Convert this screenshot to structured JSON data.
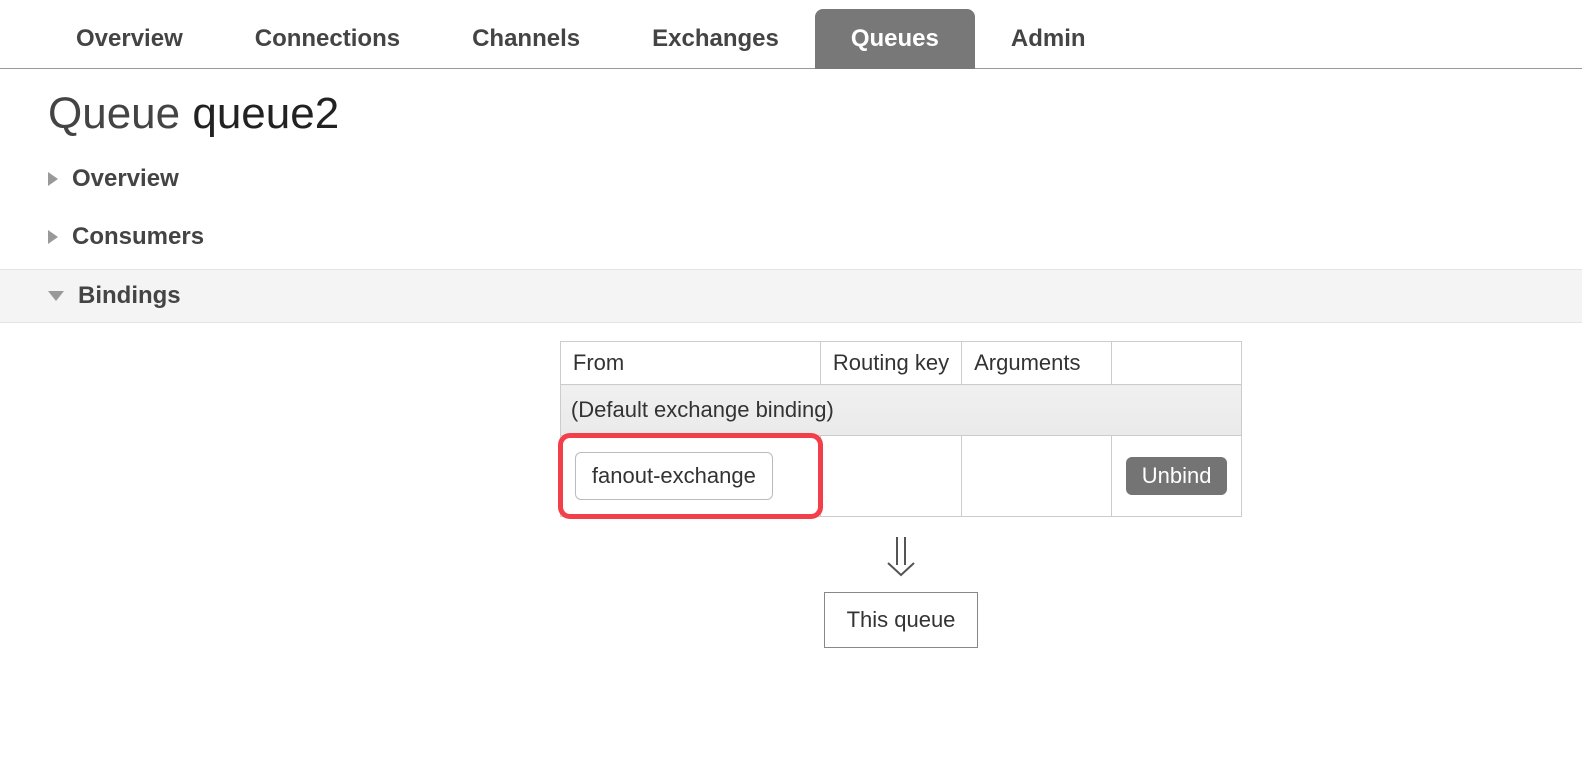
{
  "tabs": {
    "overview": "Overview",
    "connections": "Connections",
    "channels": "Channels",
    "exchanges": "Exchanges",
    "queues": "Queues",
    "admin": "Admin"
  },
  "page": {
    "title_prefix": "Queue ",
    "queue_name": "queue2"
  },
  "sections": {
    "overview": "Overview",
    "consumers": "Consumers",
    "bindings": "Bindings"
  },
  "bindings_table": {
    "headers": {
      "from": "From",
      "routing_key": "Routing key",
      "arguments": "Arguments"
    },
    "default_row": "(Default exchange binding)",
    "rows": [
      {
        "from": "fanout-exchange",
        "routing_key": "",
        "arguments": "",
        "action": "Unbind"
      }
    ],
    "this_queue": "This queue"
  }
}
